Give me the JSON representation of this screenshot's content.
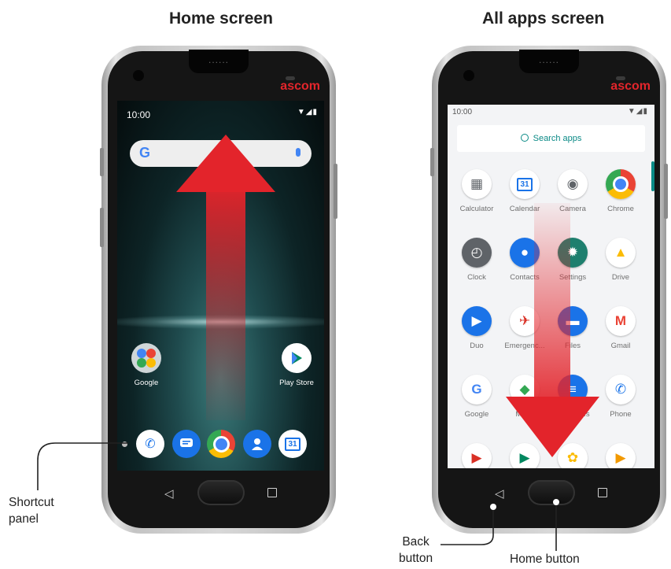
{
  "headings": {
    "home": "Home screen",
    "all_apps": "All apps screen"
  },
  "device": {
    "brand": "ascom",
    "speaker_dots": "......"
  },
  "home_screen": {
    "status_time": "10:00",
    "status_icons": "▼◢▮",
    "search_logo": "G",
    "apps": [
      {
        "label": "Google",
        "icon": "google-folder-icon"
      },
      {
        "label": "Play Store",
        "icon": "play-store-icon"
      }
    ],
    "dock": [
      "phone-icon",
      "messages-icon",
      "chrome-icon",
      "contacts-icon",
      "calendar-icon"
    ],
    "calendar_day": "31"
  },
  "all_apps_screen": {
    "status_time": "10:00",
    "status_icons": "▼◢▮",
    "search_placeholder": "Search apps",
    "apps": [
      {
        "label": "Calculator",
        "icon": "calculator-icon",
        "color": "#ffffff"
      },
      {
        "label": "Calendar",
        "icon": "calendar-icon",
        "color": "#ffffff"
      },
      {
        "label": "Camera",
        "icon": "camera-icon",
        "color": "#ffffff"
      },
      {
        "label": "Chrome",
        "icon": "chrome-icon",
        "color": "#ffffff"
      },
      {
        "label": "Clock",
        "icon": "clock-icon",
        "color": "#5f6368"
      },
      {
        "label": "Contacts",
        "icon": "contacts-icon",
        "color": "#1a73e8"
      },
      {
        "label": "Settings",
        "icon": "settings-icon",
        "color": "#1e7f6e"
      },
      {
        "label": "Drive",
        "icon": "drive-icon",
        "color": "#ffffff"
      },
      {
        "label": "Duo",
        "icon": "duo-icon",
        "color": "#1a73e8"
      },
      {
        "label": "Emergenc...",
        "icon": "emergency-icon",
        "color": "#ffffff"
      },
      {
        "label": "Files",
        "icon": "files-icon",
        "color": "#1a73e8"
      },
      {
        "label": "Gmail",
        "icon": "gmail-icon",
        "color": "#ffffff"
      },
      {
        "label": "Google",
        "icon": "google-icon",
        "color": "#ffffff"
      },
      {
        "label": "Maps",
        "icon": "maps-icon",
        "color": "#ffffff"
      },
      {
        "label": "Messages",
        "icon": "messages-icon",
        "color": "#1a73e8"
      },
      {
        "label": "Phone",
        "icon": "phone-icon",
        "color": "#ffffff"
      },
      {
        "label": "",
        "icon": "play-movies-icon",
        "color": "#ffffff"
      },
      {
        "label": "",
        "icon": "play-store-icon",
        "color": "#ffffff"
      },
      {
        "label": "",
        "icon": "photos-icon",
        "color": "#ffffff"
      },
      {
        "label": "",
        "icon": "play-games-icon",
        "color": "#ffffff"
      }
    ],
    "calendar_day": "31"
  },
  "nav": {
    "back_glyph": "◁"
  },
  "callouts": {
    "shortcut_panel": "Shortcut\npanel",
    "back_button": "Back\nbutton",
    "home_button": "Home button"
  },
  "colors": {
    "brand": "#e3252b",
    "accent": "#0a8a86",
    "arrow": "#e3242b"
  }
}
